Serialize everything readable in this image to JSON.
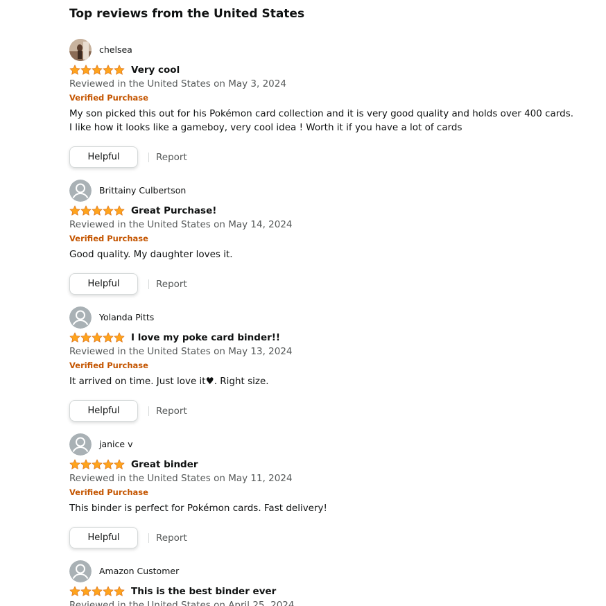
{
  "section_title": "Top reviews from the United States",
  "helpful_label": "Helpful",
  "report_label": "Report",
  "colors": {
    "star": "#ffa41c",
    "star_stroke": "#de7921",
    "verified": "#c45500",
    "secondary_text": "#565959"
  },
  "reviews": [
    {
      "name": "chelsea",
      "avatar": "user-photo",
      "rating": 5,
      "title": "Very cool",
      "date": "Reviewed in the United States on May 3, 2024",
      "verified": "Verified Purchase",
      "body": [
        "My son picked this out for his Pokémon card collection and it is very good quality and holds over 400 cards.",
        "I like how it looks like a gameboy, very cool idea ! Worth it if you have a lot of cards"
      ]
    },
    {
      "name": "Brittainy Culbertson",
      "avatar": "default-avatar",
      "rating": 5,
      "title": "Great Purchase!",
      "date": "Reviewed in the United States on May 14, 2024",
      "verified": "Verified Purchase",
      "body": [
        "Good quality. My daughter loves it."
      ]
    },
    {
      "name": "Yolanda Pitts",
      "avatar": "default-avatar",
      "rating": 5,
      "title": "I love my poke card binder!!",
      "date": "Reviewed in the United States on May 13, 2024",
      "verified": "Verified Purchase",
      "body": [
        "It arrived on time. Just love it♥. Right size."
      ]
    },
    {
      "name": "janice v",
      "avatar": "default-avatar",
      "rating": 5,
      "title": "Great binder",
      "date": "Reviewed in the United States on May 11, 2024",
      "verified": "Verified Purchase",
      "body": [
        "This binder is perfect for Pokémon cards. Fast delivery!"
      ]
    },
    {
      "name": "Amazon Customer",
      "avatar": "default-avatar",
      "rating": 5,
      "title": "This is the best binder ever",
      "date": "Reviewed in the United States on April 25, 2024",
      "verified": "",
      "body": []
    }
  ]
}
